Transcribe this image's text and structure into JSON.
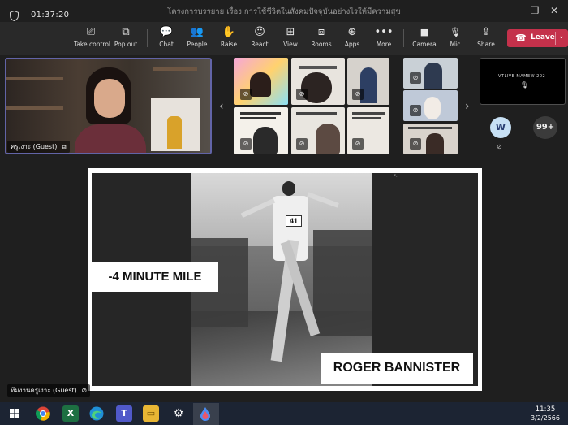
{
  "window": {
    "title": "โครงการบรรยาย เรื่อง การใช้ชีวิตในสังคมปัจจุบันอย่างไรให้มีความสุข",
    "minimize_glyph": "—",
    "restore_glyph": "❐",
    "close_glyph": "✕"
  },
  "toolbar": {
    "timer": "01:37:20",
    "buttons": [
      {
        "label": "Take control",
        "icon": "take-control-icon",
        "glyph": "⎚"
      },
      {
        "label": "Pop out",
        "icon": "pop-out-icon",
        "glyph": "⧉"
      },
      {
        "label": "Chat",
        "icon": "chat-icon",
        "glyph": "💬"
      },
      {
        "label": "People",
        "icon": "people-icon",
        "glyph": "👥"
      },
      {
        "label": "Raise",
        "icon": "raise-hand-icon",
        "glyph": "✋"
      },
      {
        "label": "React",
        "icon": "react-icon",
        "glyph": "☺"
      },
      {
        "label": "View",
        "icon": "view-icon",
        "glyph": "⊞"
      },
      {
        "label": "Rooms",
        "icon": "rooms-icon",
        "glyph": "⧈"
      },
      {
        "label": "Apps",
        "icon": "apps-icon",
        "glyph": "⊕"
      },
      {
        "label": "More",
        "icon": "more-icon",
        "glyph": "•••"
      },
      {
        "label": "Camera",
        "icon": "camera-icon",
        "glyph": "■"
      },
      {
        "label": "Mic",
        "icon": "mic-off-icon",
        "glyph": "🎙"
      },
      {
        "label": "Share",
        "icon": "share-icon",
        "glyph": "⇪"
      }
    ],
    "leave_label": "Leave"
  },
  "meeting": {
    "speaker_name": "ครูเงาะ (Guest)",
    "self_label": "VTLIVE MAMEW 202",
    "avatar_initial": "W",
    "more_count": "99+",
    "presenter_name": "ทีมงานครูเงาะ (Guest)"
  },
  "slide": {
    "mile_text": "-4 MINUTE MILE",
    "name_text": "ROGER BANNISTER"
  },
  "taskbar": {
    "time": "11:35",
    "date": "3/2/2566"
  },
  "colors": {
    "leave": "#c4314b",
    "accent": "#6264a7",
    "toolbar_bg": "#292929",
    "stage_bg": "#1f1f1f",
    "taskbar_bg": "#1c2433"
  }
}
